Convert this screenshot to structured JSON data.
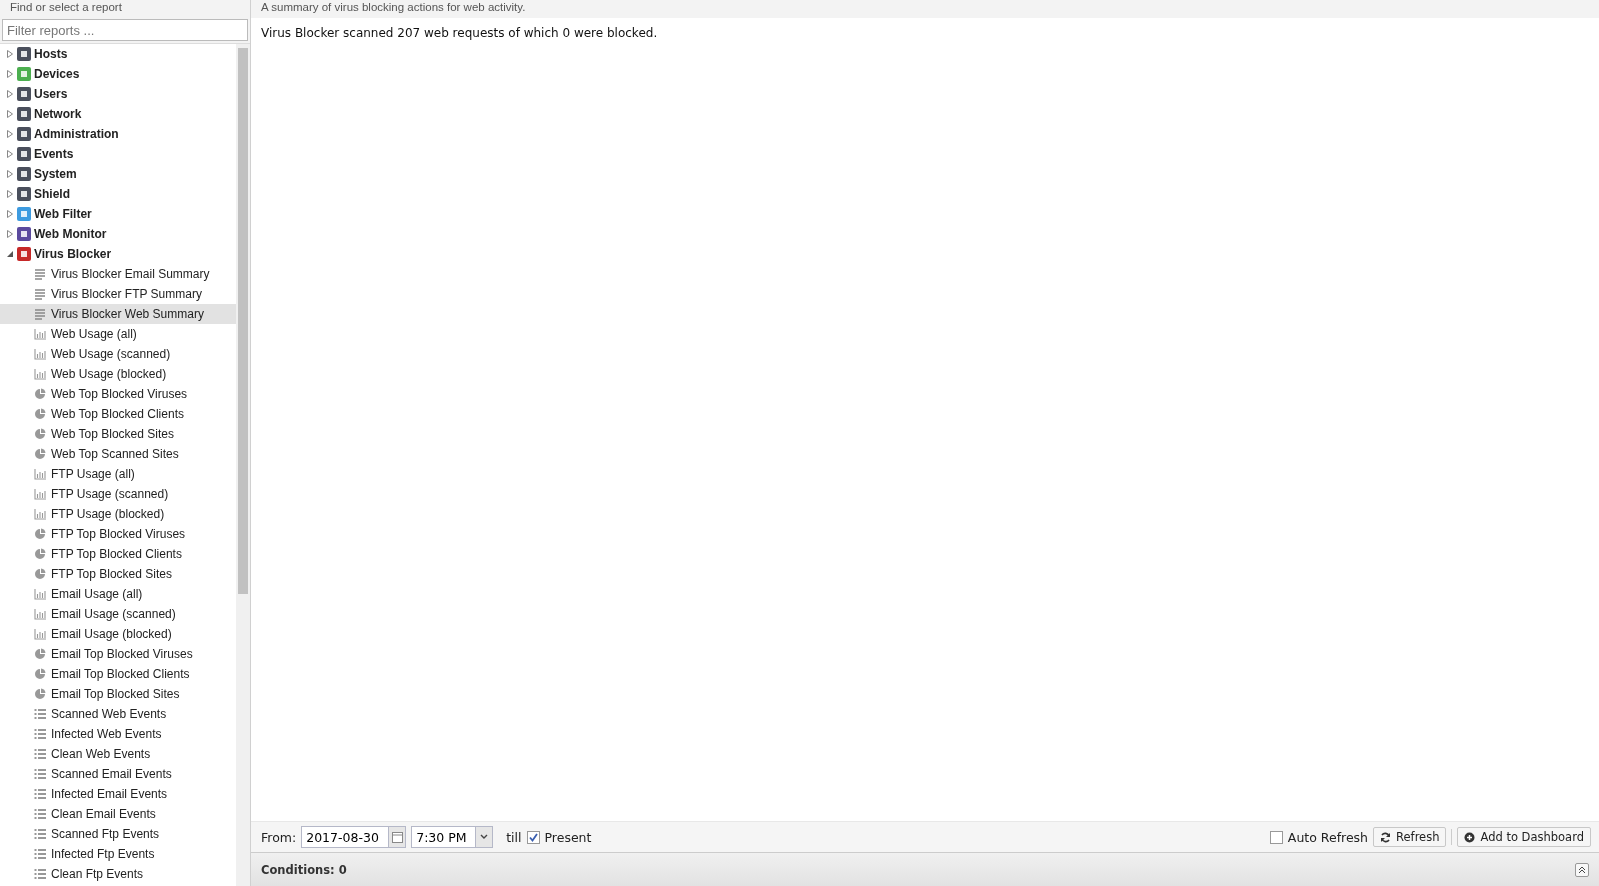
{
  "sidebar": {
    "title": "Find or select a report",
    "filter": {
      "placeholder": "Filter reports ..."
    },
    "tree": [
      {
        "label": "Hosts",
        "color": "#4a4f5c",
        "expanded": false
      },
      {
        "label": "Devices",
        "color": "#4caf50",
        "expanded": false
      },
      {
        "label": "Users",
        "color": "#4a4f5c",
        "expanded": false
      },
      {
        "label": "Network",
        "color": "#4a4f5c",
        "expanded": false
      },
      {
        "label": "Administration",
        "color": "#4a4f5c",
        "expanded": false
      },
      {
        "label": "Events",
        "color": "#4a4f5c",
        "expanded": false
      },
      {
        "label": "System",
        "color": "#4a4f5c",
        "expanded": false
      },
      {
        "label": "Shield",
        "color": "#4a4f5c",
        "expanded": false
      },
      {
        "label": "Web Filter",
        "color": "#3d9be0",
        "expanded": false
      },
      {
        "label": "Web Monitor",
        "color": "#5b4a9e",
        "expanded": false
      },
      {
        "label": "Virus Blocker",
        "color": "#c62828",
        "expanded": true,
        "children": [
          {
            "label": "Virus Blocker Email Summary",
            "kind": "summary",
            "selected": false
          },
          {
            "label": "Virus Blocker FTP Summary",
            "kind": "summary",
            "selected": false
          },
          {
            "label": "Virus Blocker Web Summary",
            "kind": "summary",
            "selected": true
          },
          {
            "label": "Web Usage (all)",
            "kind": "bar",
            "selected": false
          },
          {
            "label": "Web Usage (scanned)",
            "kind": "bar",
            "selected": false
          },
          {
            "label": "Web Usage (blocked)",
            "kind": "bar",
            "selected": false
          },
          {
            "label": "Web Top Blocked Viruses",
            "kind": "pie",
            "selected": false
          },
          {
            "label": "Web Top Blocked Clients",
            "kind": "pie",
            "selected": false
          },
          {
            "label": "Web Top Blocked Sites",
            "kind": "pie",
            "selected": false
          },
          {
            "label": "Web Top Scanned Sites",
            "kind": "pie",
            "selected": false
          },
          {
            "label": "FTP Usage (all)",
            "kind": "bar",
            "selected": false
          },
          {
            "label": "FTP Usage (scanned)",
            "kind": "bar",
            "selected": false
          },
          {
            "label": "FTP Usage (blocked)",
            "kind": "bar",
            "selected": false
          },
          {
            "label": "FTP Top Blocked Viruses",
            "kind": "pie",
            "selected": false
          },
          {
            "label": "FTP Top Blocked Clients",
            "kind": "pie",
            "selected": false
          },
          {
            "label": "FTP Top Blocked Sites",
            "kind": "pie",
            "selected": false
          },
          {
            "label": "Email Usage (all)",
            "kind": "bar",
            "selected": false
          },
          {
            "label": "Email Usage (scanned)",
            "kind": "bar",
            "selected": false
          },
          {
            "label": "Email Usage (blocked)",
            "kind": "bar",
            "selected": false
          },
          {
            "label": "Email Top Blocked Viruses",
            "kind": "pie",
            "selected": false
          },
          {
            "label": "Email Top Blocked Clients",
            "kind": "pie",
            "selected": false
          },
          {
            "label": "Email Top Blocked Sites",
            "kind": "pie",
            "selected": false
          },
          {
            "label": "Scanned Web Events",
            "kind": "events",
            "selected": false
          },
          {
            "label": "Infected Web Events",
            "kind": "events",
            "selected": false
          },
          {
            "label": "Clean Web Events",
            "kind": "events",
            "selected": false
          },
          {
            "label": "Scanned Email Events",
            "kind": "events",
            "selected": false
          },
          {
            "label": "Infected Email Events",
            "kind": "events",
            "selected": false
          },
          {
            "label": "Clean Email Events",
            "kind": "events",
            "selected": false
          },
          {
            "label": "Scanned Ftp Events",
            "kind": "events",
            "selected": false
          },
          {
            "label": "Infected Ftp Events",
            "kind": "events",
            "selected": false
          },
          {
            "label": "Clean Ftp Events",
            "kind": "events",
            "selected": false
          }
        ]
      }
    ]
  },
  "report": {
    "description": "A summary of virus blocking actions for web activity.",
    "text": "Virus Blocker scanned 207 web requests of which 0 were blocked."
  },
  "toolbar": {
    "from_label": "From:",
    "date": "2017-08-30",
    "time": "7:30 PM",
    "till_label": "till",
    "present": {
      "label": "Present",
      "checked": true
    },
    "auto_refresh": {
      "label": "Auto Refresh",
      "checked": false
    },
    "refresh": "Refresh",
    "add_to_dashboard": "Add to Dashboard"
  },
  "conditions": "Conditions: 0"
}
